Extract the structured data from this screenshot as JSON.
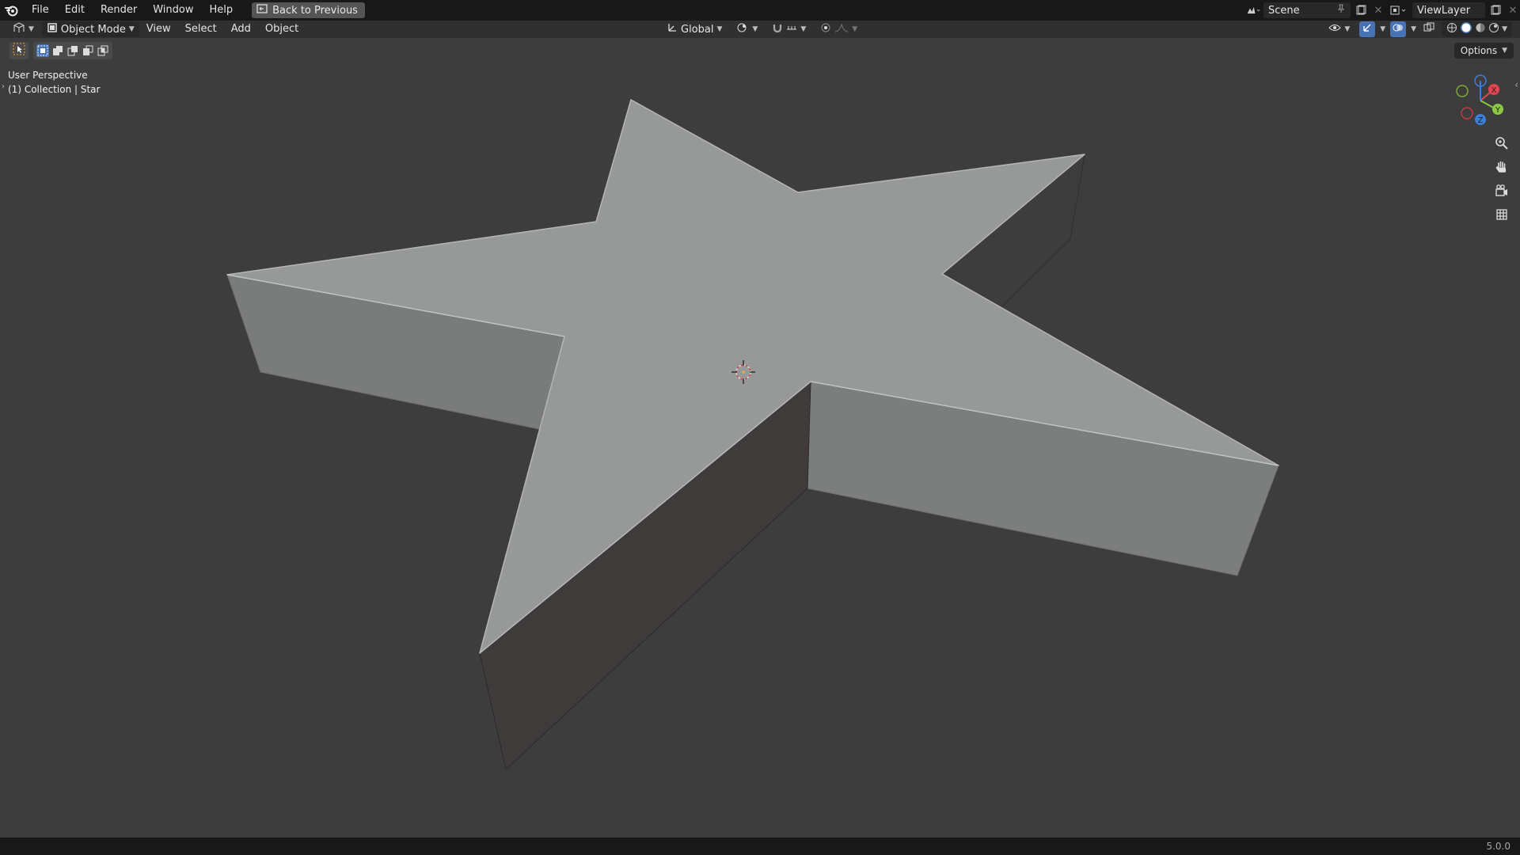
{
  "topbar": {
    "menus": [
      "File",
      "Edit",
      "Render",
      "Window",
      "Help"
    ],
    "back_label": "Back to Previous",
    "scene_name": "Scene",
    "view_layer_name": "ViewLayer"
  },
  "header": {
    "mode_label": "Object Mode",
    "menus": [
      "View",
      "Select",
      "Add",
      "Object"
    ],
    "orientation_label": "Global"
  },
  "tool_header": {
    "options_label": "Options"
  },
  "viewport": {
    "view_name": "User Perspective",
    "collection_info": "(1) Collection | Star",
    "axis_labels": {
      "x": "X",
      "y": "Y",
      "z": "Z"
    }
  },
  "statusbar": {
    "version": "5.0.0"
  },
  "colors": {
    "accent": "#4772b3",
    "axis_x": "#e04652",
    "axis_y": "#8bc740",
    "axis_z": "#3d7fd6"
  },
  "icons": {
    "navigation": [
      "zoom-icon",
      "hand-pan-icon",
      "camera-icon",
      "grid-icon"
    ]
  }
}
